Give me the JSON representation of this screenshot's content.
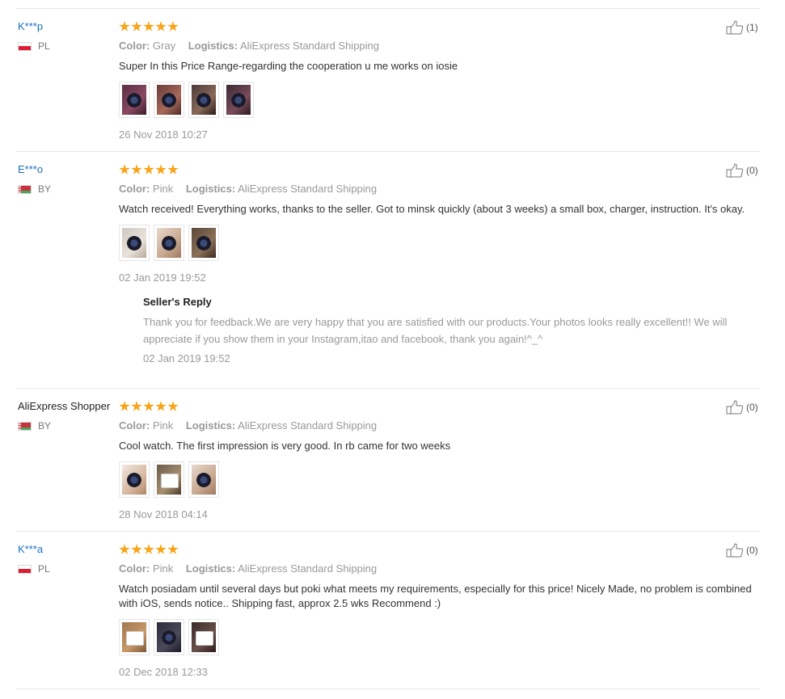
{
  "reviews": [
    {
      "user": "K***p",
      "country": "PL",
      "stars": 5,
      "color_label": "Color:",
      "color": "Gray",
      "logistics_label": "Logistics:",
      "logistics": "AliExpress Standard Shipping",
      "text": "Super In this Price Range-regarding the cooperation u me works on iosie",
      "photos": 4,
      "date": "26 Nov 2018 10:27",
      "helpful": "(1)"
    },
    {
      "user": "E***o",
      "country": "BY",
      "stars": 5,
      "color_label": "Color:",
      "color": "Pink",
      "logistics_label": "Logistics:",
      "logistics": "AliExpress Standard Shipping",
      "text": "Watch received! Everything works, thanks to the seller. Got to minsk quickly (about 3 weeks) a small box, charger, instruction. It's okay.",
      "photos": 3,
      "date": "02 Jan 2019 19:52",
      "helpful": "(0)",
      "reply": {
        "title": "Seller's Reply",
        "text": "Thank you for feedback.We are very happy that you are satisfied with our products.Your photos looks really excellent!! We will appreciate if you show them in your Instagram,itao and facebook, thank you again!^_^",
        "date": "02 Jan 2019 19:52"
      }
    },
    {
      "user": "AliExpress Shopper",
      "country": "BY",
      "stars": 5,
      "color_label": "Color:",
      "color": "Pink",
      "logistics_label": "Logistics:",
      "logistics": "AliExpress Standard Shipping",
      "text": "Cool watch. The first impression is very good. In rb came for two weeks",
      "photos": 3,
      "date": "28 Nov 2018 04:14",
      "helpful": "(0)"
    },
    {
      "user": "K***a",
      "country": "PL",
      "stars": 5,
      "color_label": "Color:",
      "color": "Pink",
      "logistics_label": "Logistics:",
      "logistics": "AliExpress Standard Shipping",
      "text": "Watch posiadam until several days but poki what meets my requirements, especially for this price! Nicely Made, no problem is combined with iOS, sends notice.. Shipping fast, approx 2.5 wks Recommend :)",
      "photos": 3,
      "date": "02 Dec 2018 12:33",
      "helpful": "(0)"
    }
  ],
  "colors": {
    "star": "#f8a418",
    "username": "#1a6fc4",
    "muted": "#999999",
    "divider": "#e8e8e8"
  },
  "icons": {
    "helpful": "thumbs-up-icon",
    "rating": "star-icon"
  }
}
